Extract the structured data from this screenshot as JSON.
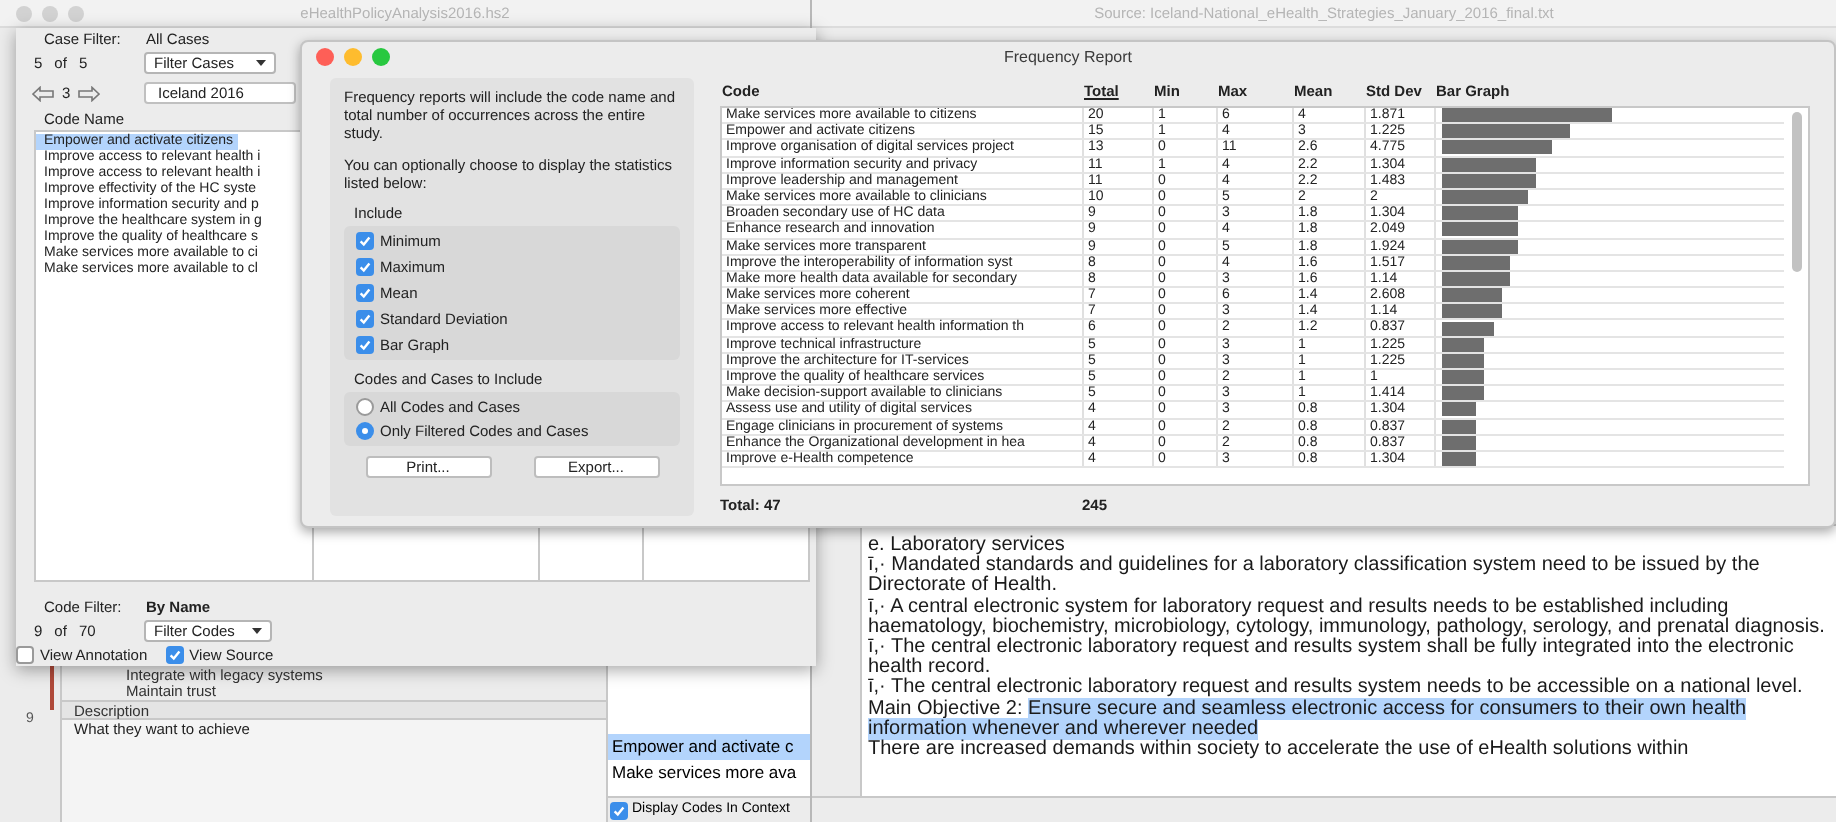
{
  "main_window": {
    "title": "eHealthPolicyAnalysis2016.hs2"
  },
  "source_window": {
    "title": "Source: Iceland-National_eHealth_Strategies_January_2016_final.txt",
    "paragraphs": [
      {
        "text": "e. Laboratory services"
      },
      {
        "text": "ī,· Mandated standards and guidelines for a laboratory classification system need to be issued by the Directorate of Health."
      },
      {
        "text": "ī,· A central electronic system for laboratory request and results needs to be established including haematology, biochemistry, microbiology, cytology, immunology, pathology, serology, and prenatal diagnosis."
      },
      {
        "text": "ī,· The central electronic laboratory request and results system shall be fully integrated into the electronic health record."
      },
      {
        "text": "ī,· The central electronic laboratory request and results system needs to be accessible on a national level."
      },
      {
        "text": "Main Objective 2: ",
        "highlight": "Ensure secure and seamless electronic access for consumers to their own health information whenever and wherever needed"
      },
      {
        "text": "There are increased demands within society to accelerate the use of eHealth solutions within"
      }
    ]
  },
  "code_panel": {
    "case_filter_label": "Case Filter:",
    "case_filter_value": "All Cases",
    "case_count": "5",
    "case_of": "of",
    "case_total": "5",
    "filter_cases_button": "Filter Cases",
    "case_index": "3",
    "case_field": "Iceland 2016",
    "list_header": "Code Name",
    "codes": [
      {
        "label": "Empower and activate citizens",
        "selected": true
      },
      {
        "label": "Improve access to relevant health i",
        "selected": false
      },
      {
        "label": "Improve access to relevant health i",
        "selected": false
      },
      {
        "label": "Improve effectivity of the HC syste",
        "selected": false
      },
      {
        "label": "Improve information security and p",
        "selected": false
      },
      {
        "label": "Improve the healthcare system in g",
        "selected": false
      },
      {
        "label": "Improve the quality of healthcare s",
        "selected": false
      },
      {
        "label": "Make services more available to ci",
        "selected": false
      },
      {
        "label": "Make services more available to cl",
        "selected": false
      }
    ],
    "code_filter_label": "Code Filter:",
    "code_filter_value": "By Name",
    "code_count": "9",
    "code_of": "of",
    "code_total": "70",
    "filter_codes_button": "Filter Codes",
    "view_annotation": {
      "label": "View Annotation",
      "checked": false
    },
    "view_source": {
      "label": "View Source",
      "checked": true
    }
  },
  "outline": {
    "items": [
      "Integrate with legacy systems",
      "Maintain trust"
    ],
    "description_header": "Description",
    "line_number": "9",
    "description": "What they want to achieve"
  },
  "codes_in_context": {
    "items": [
      {
        "label": "Empower and activate c",
        "selected": true
      },
      {
        "label": "Make services more ava",
        "selected": false
      }
    ],
    "display_in_context": {
      "label": "Display Codes In Context",
      "checked": true
    }
  },
  "frequency_report": {
    "title": "Frequency Report",
    "intro": "Frequency reports will include the code name and total number of occurrences across the entire study.",
    "options_text": "You can optionally choose to display the statistics listed below:",
    "include_title": "Include",
    "options": [
      {
        "label": "Minimum",
        "checked": true
      },
      {
        "label": "Maximum",
        "checked": true
      },
      {
        "label": "Mean",
        "checked": true
      },
      {
        "label": "Standard Deviation",
        "checked": true
      },
      {
        "label": "Bar Graph",
        "checked": true
      }
    ],
    "scope_title": "Codes and Cases to Include",
    "scope": [
      {
        "label": "All Codes and Cases",
        "selected": false
      },
      {
        "label": "Only Filtered Codes and Cases",
        "selected": true
      }
    ],
    "buttons": [
      "Print...",
      "Export..."
    ],
    "columns": [
      {
        "label": "Code",
        "sorted": false
      },
      {
        "label": "Total",
        "sorted": true
      },
      {
        "label": "Min",
        "sorted": false
      },
      {
        "label": "Max",
        "sorted": false
      },
      {
        "label": "Mean",
        "sorted": false
      },
      {
        "label": "Std Dev",
        "sorted": false
      },
      {
        "label": "Bar Graph",
        "sorted": false
      }
    ],
    "rows": [
      {
        "code": "Make services more available to citizens",
        "total": "20",
        "min": "1",
        "max": "6",
        "mean": "4",
        "std_dev": "1.871"
      },
      {
        "code": "Empower and activate citizens",
        "total": "15",
        "min": "1",
        "max": "4",
        "mean": "3",
        "std_dev": "1.225"
      },
      {
        "code": "Improve organisation of digital services project",
        "total": "13",
        "min": "0",
        "max": "11",
        "mean": "2.6",
        "std_dev": "4.775"
      },
      {
        "code": "Improve information security and privacy",
        "total": "11",
        "min": "1",
        "max": "4",
        "mean": "2.2",
        "std_dev": "1.304"
      },
      {
        "code": "Improve leadership and management",
        "total": "11",
        "min": "0",
        "max": "4",
        "mean": "2.2",
        "std_dev": "1.483"
      },
      {
        "code": "Make services more available to clinicians",
        "total": "10",
        "min": "0",
        "max": "5",
        "mean": "2",
        "std_dev": "2"
      },
      {
        "code": "Broaden secondary use of HC data",
        "total": "9",
        "min": "0",
        "max": "3",
        "mean": "1.8",
        "std_dev": "1.304"
      },
      {
        "code": "Enhance research and innovation",
        "total": "9",
        "min": "0",
        "max": "4",
        "mean": "1.8",
        "std_dev": "2.049"
      },
      {
        "code": "Make services more transparent",
        "total": "9",
        "min": "0",
        "max": "5",
        "mean": "1.8",
        "std_dev": "1.924"
      },
      {
        "code": "Improve the interoperability of information syst",
        "total": "8",
        "min": "0",
        "max": "4",
        "mean": "1.6",
        "std_dev": "1.517"
      },
      {
        "code": "Make more health data available for secondary",
        "total": "8",
        "min": "0",
        "max": "3",
        "mean": "1.6",
        "std_dev": "1.14"
      },
      {
        "code": "Make services more coherent",
        "total": "7",
        "min": "0",
        "max": "6",
        "mean": "1.4",
        "std_dev": "2.608"
      },
      {
        "code": "Make services more effective",
        "total": "7",
        "min": "0",
        "max": "3",
        "mean": "1.4",
        "std_dev": "1.14"
      },
      {
        "code": "Improve access to relevant health information th",
        "total": "6",
        "min": "0",
        "max": "2",
        "mean": "1.2",
        "std_dev": "0.837"
      },
      {
        "code": "Improve technical infrastructure",
        "total": "5",
        "min": "0",
        "max": "3",
        "mean": "1",
        "std_dev": "1.225"
      },
      {
        "code": "Improve the architecture for IT-services",
        "total": "5",
        "min": "0",
        "max": "3",
        "mean": "1",
        "std_dev": "1.225"
      },
      {
        "code": "Improve the quality of healthcare services",
        "total": "5",
        "min": "0",
        "max": "2",
        "mean": "1",
        "std_dev": "1"
      },
      {
        "code": "Make decision-support available to clinicians",
        "total": "5",
        "min": "0",
        "max": "3",
        "mean": "1",
        "std_dev": "1.414"
      },
      {
        "code": "Assess use and utility of digital services",
        "total": "4",
        "min": "0",
        "max": "3",
        "mean": "0.8",
        "std_dev": "1.304"
      },
      {
        "code": "Engage clinicians in procurement of systems",
        "total": "4",
        "min": "0",
        "max": "2",
        "mean": "0.8",
        "std_dev": "0.837"
      },
      {
        "code": "Enhance the Organizational development in hea",
        "total": "4",
        "min": "0",
        "max": "2",
        "mean": "0.8",
        "std_dev": "0.837"
      },
      {
        "code": "Improve e-Health competence",
        "total": "4",
        "min": "0",
        "max": "3",
        "mean": "0.8",
        "std_dev": "1.304"
      }
    ],
    "total_label": "Total: 47",
    "total_sum": "245"
  }
}
